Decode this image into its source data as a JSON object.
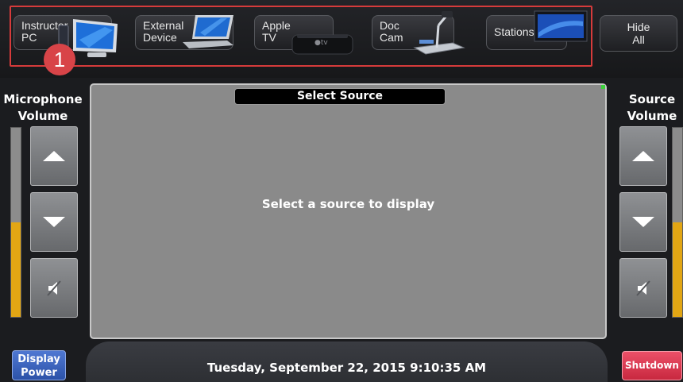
{
  "sources": [
    {
      "label": "Instructor\nPC"
    },
    {
      "label": "External\nDevice"
    },
    {
      "label": "Apple\nTV"
    },
    {
      "label": "Doc\nCam"
    },
    {
      "label": "Stations"
    }
  ],
  "hide_all_label": "Hide\nAll",
  "annotation_number": "1",
  "mic_volume": {
    "title": "Microphone\nVolume",
    "level": 0.5
  },
  "source_volume": {
    "title": "Source\nVolume",
    "level": 0.5
  },
  "main": {
    "title": "Select Source",
    "message": "Select a source to display"
  },
  "footer": {
    "datetime": "Tuesday, September 22, 2015 9:10:35 AM"
  },
  "display_power_label": "Display\nPower",
  "shutdown_label": "Shutdown",
  "colors": {
    "highlight": "#d63b3b",
    "volume_fill": "#e2a614",
    "display_power": "#3a63be",
    "shutdown": "#dc3b53"
  }
}
